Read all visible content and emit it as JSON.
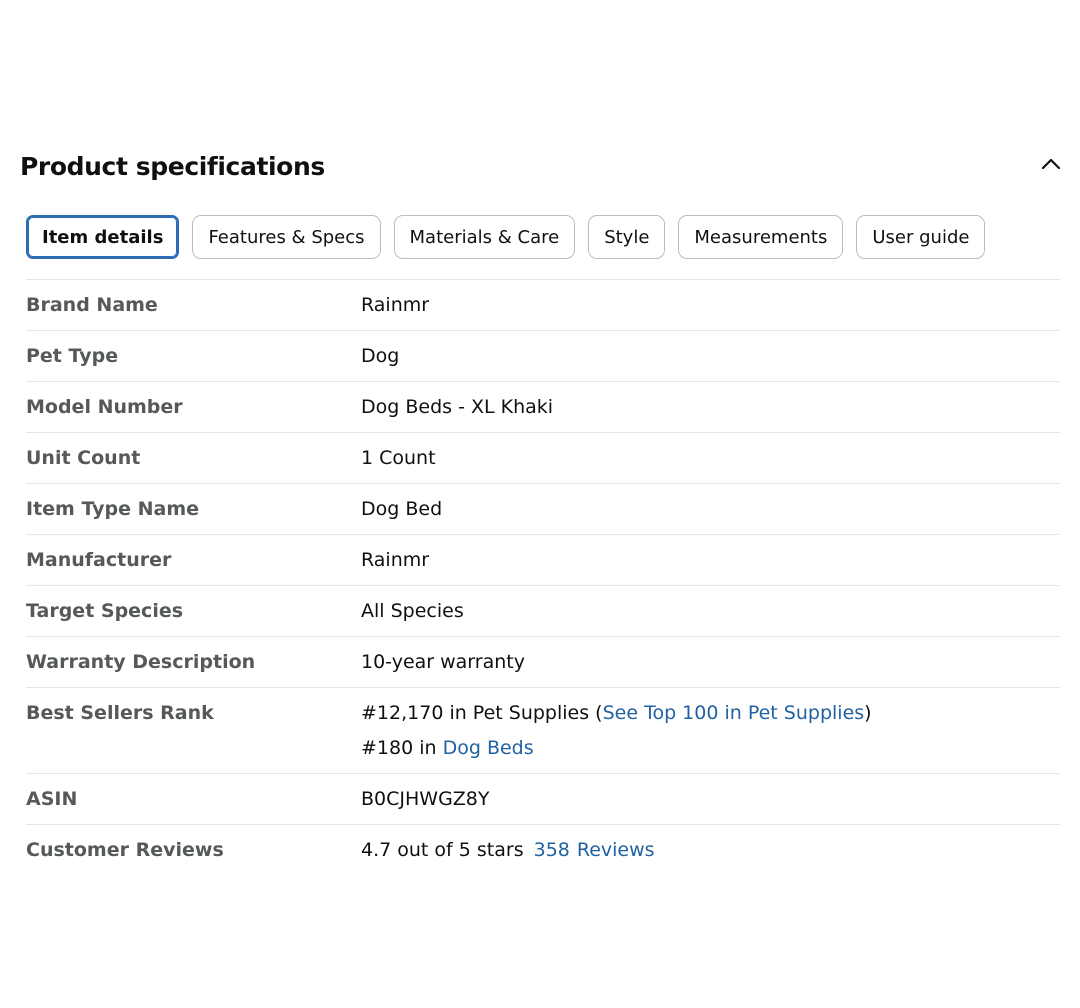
{
  "section": {
    "title": "Product specifications"
  },
  "tabs": [
    {
      "label": "Item details",
      "active": true
    },
    {
      "label": "Features & Specs",
      "active": false
    },
    {
      "label": "Materials & Care",
      "active": false
    },
    {
      "label": "Style",
      "active": false
    },
    {
      "label": "Measurements",
      "active": false
    },
    {
      "label": "User guide",
      "active": false
    }
  ],
  "specs": {
    "brand_name": {
      "label": "Brand Name",
      "value": "Rainmr"
    },
    "pet_type": {
      "label": "Pet Type",
      "value": "Dog"
    },
    "model_number": {
      "label": "Model Number",
      "value": "Dog Beds - XL Khaki"
    },
    "unit_count": {
      "label": "Unit Count",
      "value": "1 Count"
    },
    "item_type_name": {
      "label": "Item Type Name",
      "value": "Dog Bed"
    },
    "manufacturer": {
      "label": "Manufacturer",
      "value": "Rainmr"
    },
    "target_species": {
      "label": "Target Species",
      "value": "All Species"
    },
    "warranty": {
      "label": "Warranty Description",
      "value": "10-year warranty"
    },
    "best_sellers": {
      "label": "Best Sellers Rank",
      "rank1_prefix": "#12,170 in Pet Supplies (",
      "rank1_link": "See Top 100 in Pet Supplies",
      "rank1_suffix": ")",
      "rank2_prefix": "#180 in ",
      "rank2_link": "Dog Beds"
    },
    "asin": {
      "label": "ASIN",
      "value": "B0CJHWGZ8Y"
    },
    "customer_reviews": {
      "label": "Customer Reviews",
      "rating_text": "4.7 out of 5 stars",
      "review_count": "358",
      "reviews_label": "Reviews"
    }
  },
  "icons": {
    "collapse": "chevron-up-icon"
  },
  "colors": {
    "link": "#2162a1",
    "label": "#565959",
    "active_tab_border": "#2d6cb5"
  }
}
